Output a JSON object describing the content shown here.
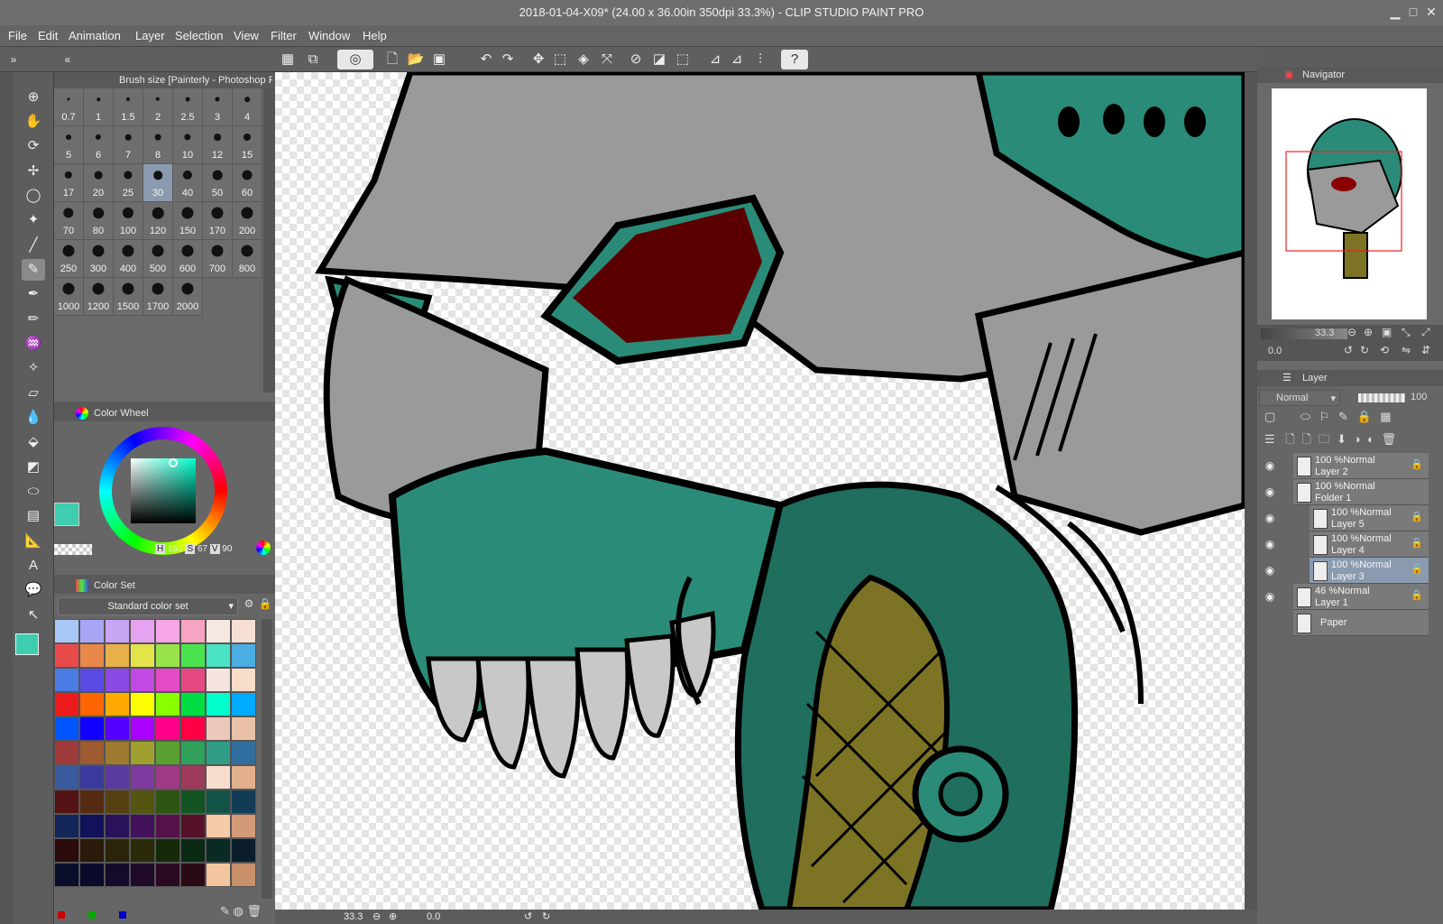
{
  "window": {
    "title": "2018-01-04-X09* (24.00 x 36.00in 350dpi 33.3%)  - CLIP STUDIO PAINT PRO",
    "minimize": "▁",
    "maximize": "□",
    "close": "✕"
  },
  "menu": [
    "File",
    "Edit",
    "Animation",
    "Layer",
    "Selection",
    "View",
    "Filter",
    "Window",
    "Help"
  ],
  "brush_panel": {
    "title": "Brush size [Painterly - Photoshop Round]",
    "sizes": [
      "0.7",
      "1",
      "1.5",
      "2",
      "2.5",
      "3",
      "4",
      "5",
      "6",
      "7",
      "8",
      "10",
      "12",
      "15",
      "17",
      "20",
      "25",
      "30",
      "40",
      "50",
      "60",
      "70",
      "80",
      "100",
      "120",
      "150",
      "170",
      "200",
      "250",
      "300",
      "400",
      "500",
      "600",
      "700",
      "800",
      "1000",
      "1200",
      "1500",
      "1700",
      "2000"
    ],
    "selected": "30"
  },
  "color_wheel": {
    "title": "Color Wheel",
    "h_label": "H",
    "h": "167",
    "s_label": "S",
    "s": "67",
    "v_label": "V",
    "v": "90",
    "main_color": "#3fcdb0",
    "sub_color": "#0a0af0"
  },
  "color_set": {
    "title": "Color Set",
    "set_name": "Standard color set",
    "swatches": [
      "#a9c8f7",
      "#a9a6f5",
      "#c7a6f5",
      "#e6a3f0",
      "#f6a6e6",
      "#f7a3c3",
      "#f7e7e3",
      "#f7e0d3",
      "#e84a4a",
      "#e8884a",
      "#e8b04a",
      "#e3e34a",
      "#99e34a",
      "#4ae34f",
      "#4ae3c3",
      "#4aaee3",
      "#4a7ce3",
      "#5a4ae3",
      "#8a4ae3",
      "#c14ae3",
      "#e34ac6",
      "#e34a81",
      "#f4e3df",
      "#f7dcc8",
      "#ed1c1c",
      "#ff6600",
      "#ffaa00",
      "#ffff00",
      "#88ff00",
      "#00dd44",
      "#00ffcc",
      "#00aaff",
      "#0055ff",
      "#1100ff",
      "#5500ff",
      "#aa00ff",
      "#ff0088",
      "#ff0044",
      "#ebc8b9",
      "#eac2a8",
      "#9e3a3a",
      "#9e5a30",
      "#9e7a30",
      "#a0a030",
      "#5aa030",
      "#30a05a",
      "#309e86",
      "#306e9e",
      "#3a5a9e",
      "#3a3a9e",
      "#5a3a9e",
      "#7e3a9e",
      "#9e3a86",
      "#9e3a5a",
      "#f8dccb",
      "#e2b08d",
      "#551212",
      "#552a12",
      "#554012",
      "#555512",
      "#2e5512",
      "#125522",
      "#125546",
      "#123c55",
      "#12265a",
      "#12125a",
      "#2a125a",
      "#42125a",
      "#55124a",
      "#551228",
      "#f6cba8",
      "#d49a78",
      "#2a0a0a",
      "#2a1a0a",
      "#2a240a",
      "#2a2a0a",
      "#162a0a",
      "#0a2a14",
      "#0a2a24",
      "#0a1e2a",
      "#0a0e2a",
      "#0a0a2a",
      "#140a2a",
      "#200a2a",
      "#2a0a22",
      "#2a0a14",
      "#f4c6a0",
      "#c8916a"
    ],
    "bottom_chips": [
      "#cc0000",
      "#00aa00",
      "#0000cc"
    ]
  },
  "navigator": {
    "title": "Navigator",
    "zoom": "33.3",
    "rotation": "0.0"
  },
  "layer_panel": {
    "title": "Layer",
    "blend_mode": "Normal",
    "opacity": "100",
    "layers": [
      {
        "line1": "100 %Normal",
        "line2": "Layer 2",
        "indent": 0,
        "selected": false
      },
      {
        "line1": "100 %Normal",
        "line2": "Folder 1",
        "indent": 0,
        "selected": false
      },
      {
        "line1": "100 %Normal",
        "line2": "Layer 5",
        "indent": 1,
        "selected": false
      },
      {
        "line1": "100 %Normal",
        "line2": "Layer 4",
        "indent": 1,
        "selected": false
      },
      {
        "line1": "100 %Normal",
        "line2": "Layer 3",
        "indent": 1,
        "selected": true
      },
      {
        "line1": "46 %Normal",
        "line2": "Layer 1",
        "indent": 0,
        "selected": false
      },
      {
        "line1": "",
        "line2": "Paper",
        "indent": 0,
        "selected": false
      }
    ]
  },
  "status": {
    "zoom": "33.3",
    "rotation": "0.0"
  },
  "colors": {
    "teal": "#2a8c78",
    "teal_light": "#3fcdb0",
    "gray": "#9a9a9a",
    "red_eye": "#5a0000",
    "olive": "#7c7424",
    "selected_row": "#8a9bb0"
  },
  "icons": [
    "zoom-icon",
    "hand-icon",
    "rotate-icon",
    "move-icon",
    "lasso-icon",
    "magic-wand-icon",
    "eyedropper-icon",
    "brush-icon",
    "pen-icon",
    "pencil-icon",
    "airbrush-icon",
    "decoration-icon",
    "eraser-icon",
    "blend-icon",
    "fill-icon",
    "gradient-icon",
    "figure-icon",
    "frame-icon",
    "ruler-icon",
    "text-icon",
    "balloon-icon",
    "correction-icon"
  ]
}
